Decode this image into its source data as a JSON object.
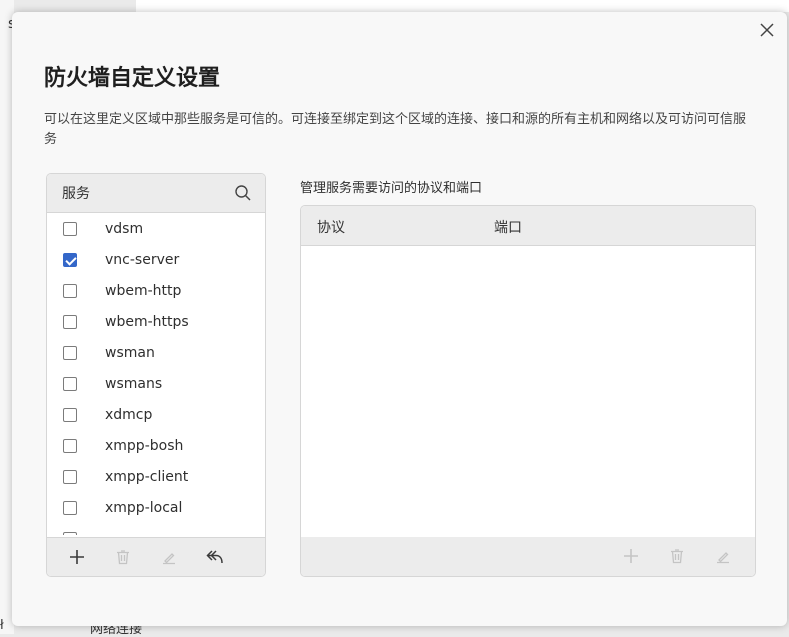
{
  "background": {
    "left_char": "s",
    "bottom_left_char": "ł",
    "bottom_text": "网络连接"
  },
  "dialog": {
    "title": "防火墙自定义设置",
    "description": "可以在这里定义区域中那些服务是可信的。可连接至绑定到这个区域的连接、接口和源的所有主机和网络以及可访问可信服务",
    "close_icon": "close-icon"
  },
  "services": {
    "header_label": "服务",
    "search_icon": "search-icon",
    "items": [
      {
        "name": "vdsm",
        "checked": false
      },
      {
        "name": "vnc-server",
        "checked": true
      },
      {
        "name": "wbem-http",
        "checked": false
      },
      {
        "name": "wbem-https",
        "checked": false
      },
      {
        "name": "wsman",
        "checked": false
      },
      {
        "name": "wsmans",
        "checked": false
      },
      {
        "name": "xdmcp",
        "checked": false
      },
      {
        "name": "xmpp-bosh",
        "checked": false
      },
      {
        "name": "xmpp-client",
        "checked": false
      },
      {
        "name": "xmpp-local",
        "checked": false
      },
      {
        "name": "",
        "checked": false
      }
    ],
    "toolbar": {
      "add_icon": "plus-icon",
      "delete_icon": "trash-icon",
      "edit_icon": "pencil-icon",
      "undo_icon": "undo-icon"
    }
  },
  "ports": {
    "label": "管理服务需要访问的协议和端口",
    "columns": {
      "protocol": "协议",
      "port": "端口"
    },
    "rows": [],
    "toolbar": {
      "add_icon": "plus-icon",
      "delete_icon": "trash-icon",
      "edit_icon": "pencil-icon"
    }
  },
  "colors": {
    "accent": "#3467c9",
    "icon_active": "#3a3a3a",
    "icon_disabled": "#c4c4c4"
  }
}
